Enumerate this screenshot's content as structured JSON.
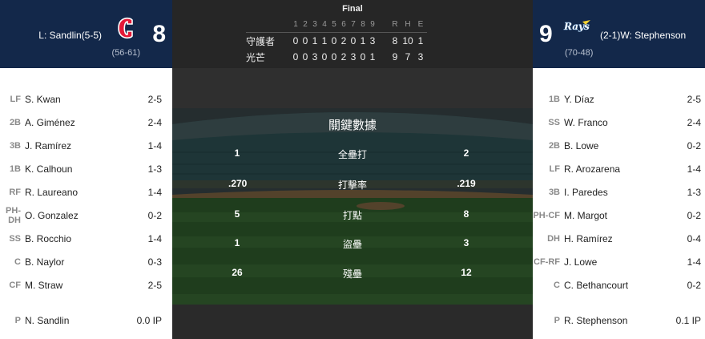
{
  "game": {
    "status": "Final",
    "away": {
      "score": "8",
      "pitcher": "L: Sandlin(5-5)",
      "record": "(56-61)",
      "logo": "guardians-logo",
      "color": "#13284a",
      "accent": "#e31937"
    },
    "home": {
      "score": "9",
      "pitcher": "(2-1)W: Stephenson",
      "record": "(70-48)",
      "logo": "rays-logo",
      "color": "#13284a"
    }
  },
  "linescore": {
    "innings": [
      "1",
      "2",
      "3",
      "4",
      "5",
      "6",
      "7",
      "8",
      "9"
    ],
    "rhe_headers": [
      "R",
      "H",
      "E"
    ],
    "rows": [
      {
        "team": "守護者",
        "innings": [
          "0",
          "0",
          "1",
          "1",
          "0",
          "2",
          "0",
          "1",
          "3"
        ],
        "rhe": [
          "8",
          "10",
          "1"
        ]
      },
      {
        "team": "光芒",
        "innings": [
          "0",
          "0",
          "3",
          "0",
          "0",
          "2",
          "3",
          "0",
          "1"
        ],
        "rhe": [
          "9",
          "7",
          "3"
        ]
      }
    ]
  },
  "key_stats": {
    "title": "關鍵數據",
    "rows": [
      {
        "label": "全壘打",
        "away": "1",
        "home": "2"
      },
      {
        "label": "打擊率",
        "away": ".270",
        "home": ".219"
      },
      {
        "label": "打點",
        "away": "5",
        "home": "8"
      },
      {
        "label": "盜壘",
        "away": "1",
        "home": "3"
      },
      {
        "label": "殘壘",
        "away": "26",
        "home": "12"
      }
    ]
  },
  "away_lineup": [
    {
      "pos": "LF",
      "name": "S. Kwan",
      "stat": "2-5"
    },
    {
      "pos": "2B",
      "name": "A. Giménez",
      "stat": "2-4"
    },
    {
      "pos": "3B",
      "name": "J. Ramírez",
      "stat": "1-4"
    },
    {
      "pos": "1B",
      "name": "K. Calhoun",
      "stat": "1-3"
    },
    {
      "pos": "RF",
      "name": "R. Laureano",
      "stat": "1-4"
    },
    {
      "pos": "PH-DH",
      "name": "O. Gonzalez",
      "stat": "0-2"
    },
    {
      "pos": "SS",
      "name": "B. Rocchio",
      "stat": "1-4"
    },
    {
      "pos": "C",
      "name": "B. Naylor",
      "stat": "0-3"
    },
    {
      "pos": "CF",
      "name": "M. Straw",
      "stat": "2-5"
    }
  ],
  "away_pitcher": {
    "pos": "P",
    "name": "N. Sandlin",
    "stat": "0.0 IP"
  },
  "home_lineup": [
    {
      "pos": "1B",
      "name": "Y. Díaz",
      "stat": "2-5"
    },
    {
      "pos": "SS",
      "name": "W. Franco",
      "stat": "2-4"
    },
    {
      "pos": "2B",
      "name": "B. Lowe",
      "stat": "0-2"
    },
    {
      "pos": "LF",
      "name": "R. Arozarena",
      "stat": "1-4"
    },
    {
      "pos": "3B",
      "name": "I. Paredes",
      "stat": "1-3"
    },
    {
      "pos": "PH-CF",
      "name": "M. Margot",
      "stat": "0-2"
    },
    {
      "pos": "DH",
      "name": "H. Ramírez",
      "stat": "0-4"
    },
    {
      "pos": "CF-RF",
      "name": "J. Lowe",
      "stat": "1-4"
    },
    {
      "pos": "C",
      "name": "C. Bethancourt",
      "stat": "0-2"
    }
  ],
  "home_pitcher": {
    "pos": "P",
    "name": "R. Stephenson",
    "stat": "0.1 IP"
  }
}
